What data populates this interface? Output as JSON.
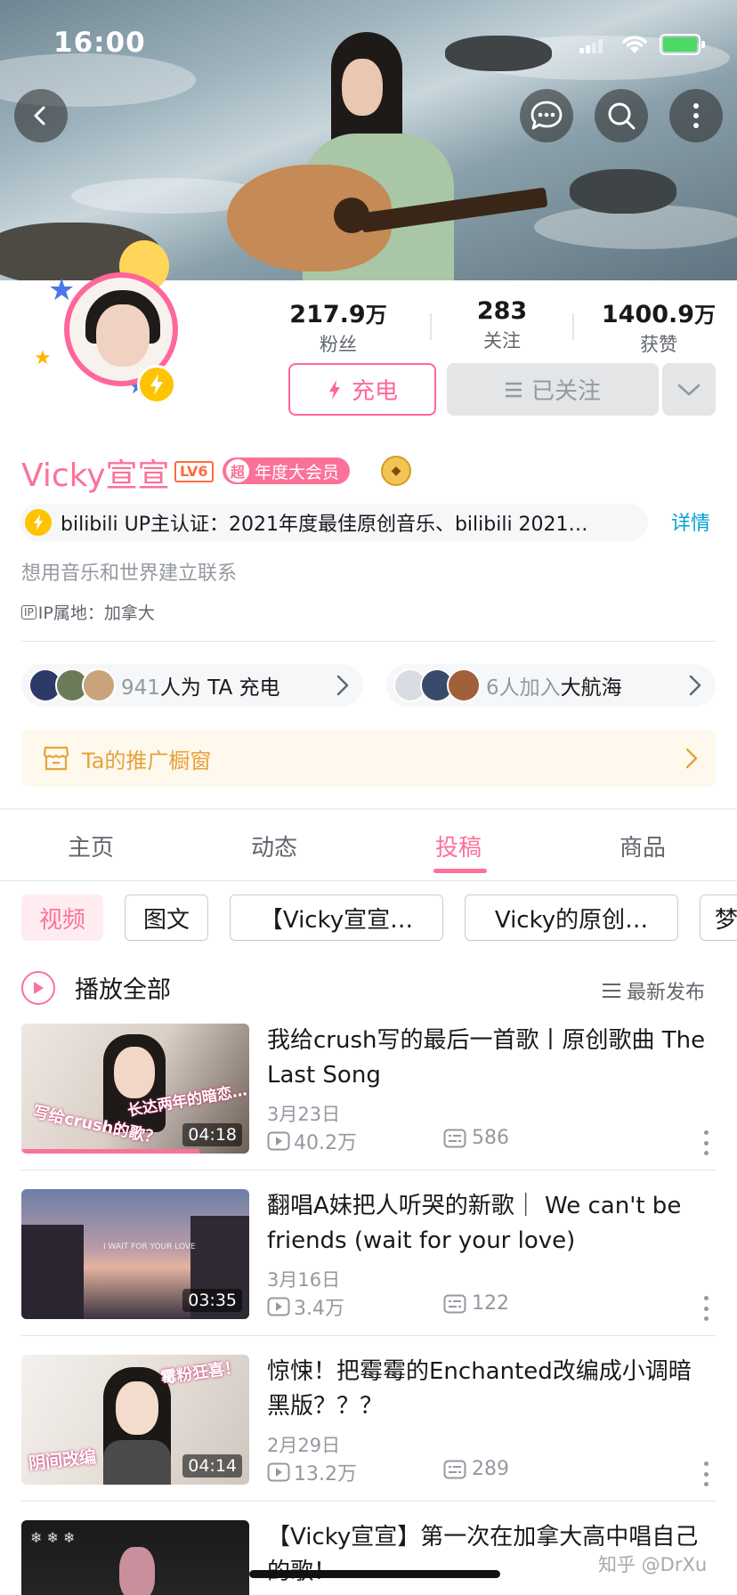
{
  "status_bar": {
    "time": "16:00"
  },
  "profile": {
    "name": "Vicky宣宣",
    "level": "LV6",
    "vip_prefix": "超",
    "vip_label": "年度大会员",
    "stats": [
      {
        "num": "217.9",
        "unit": "万",
        "label": "粉丝"
      },
      {
        "num": "283",
        "unit": "",
        "label": "关注"
      },
      {
        "num": "1400.9",
        "unit": "万",
        "label": "获赞"
      }
    ],
    "charge_button": "充电",
    "followed_button": "已关注",
    "certification": "bilibili UP主认证：2021年度最佳原创音乐、bilibili 2021…",
    "certification_detail": "详情",
    "signature": "想用音乐和世界建立联系",
    "ip_icon": "IP",
    "ip_location": "IP属地：加拿大"
  },
  "supporters": {
    "charge_count": "941",
    "charge_text": "人为 TA 充电",
    "crew_count": "6",
    "crew_text_gray": "人加入",
    "crew_text": "大航海"
  },
  "shop_window": {
    "label": "Ta的推广橱窗"
  },
  "tabs": [
    {
      "label": "主页"
    },
    {
      "label": "动态"
    },
    {
      "label": "投稿",
      "active": true
    },
    {
      "label": "商品"
    }
  ],
  "filter_chips": [
    {
      "label": "视频",
      "active": true
    },
    {
      "label": "图文"
    },
    {
      "label": "【Vicky宣宣…"
    },
    {
      "label": "Vicky的原创…"
    },
    {
      "label": "梦"
    }
  ],
  "list_header": {
    "play_all": "播放全部",
    "sort": "最新发布"
  },
  "videos": [
    {
      "title": "我给crush写的最后一首歌丨原创歌曲 The Last Song",
      "date": "3月23日",
      "plays": "40.2万",
      "danmaku": "586",
      "duration": "04:18",
      "thumb_text_1": "长达两年的暗恋…",
      "thumb_text_2": "写给crush的歌？",
      "watched_progress": 0.78
    },
    {
      "title": "翻唱A妹把人听哭的新歌｜ We can't be friends (wait for your love)",
      "date": "3月16日",
      "plays": "3.4万",
      "danmaku": "122",
      "duration": "03:35",
      "thumb_text_1": "I WAIT FOR YOUR LOVE"
    },
    {
      "title": "惊悚！把霉霉的Enchanted改编成小调暗黑版？？？",
      "date": "2月29日",
      "plays": "13.2万",
      "danmaku": "289",
      "duration": "04:14",
      "thumb_text_1": "霉粉狂喜！",
      "thumb_text_2": "阴间改编"
    },
    {
      "title": "【Vicky宣宣】第一次在加拿大高中唱自己的歌！"
    }
  ],
  "watermark": "知乎 @DrXu",
  "colors": {
    "accent": "#fb7299",
    "link": "#00a1d6",
    "charge": "#ffc300",
    "shop": "#e6a23c"
  }
}
